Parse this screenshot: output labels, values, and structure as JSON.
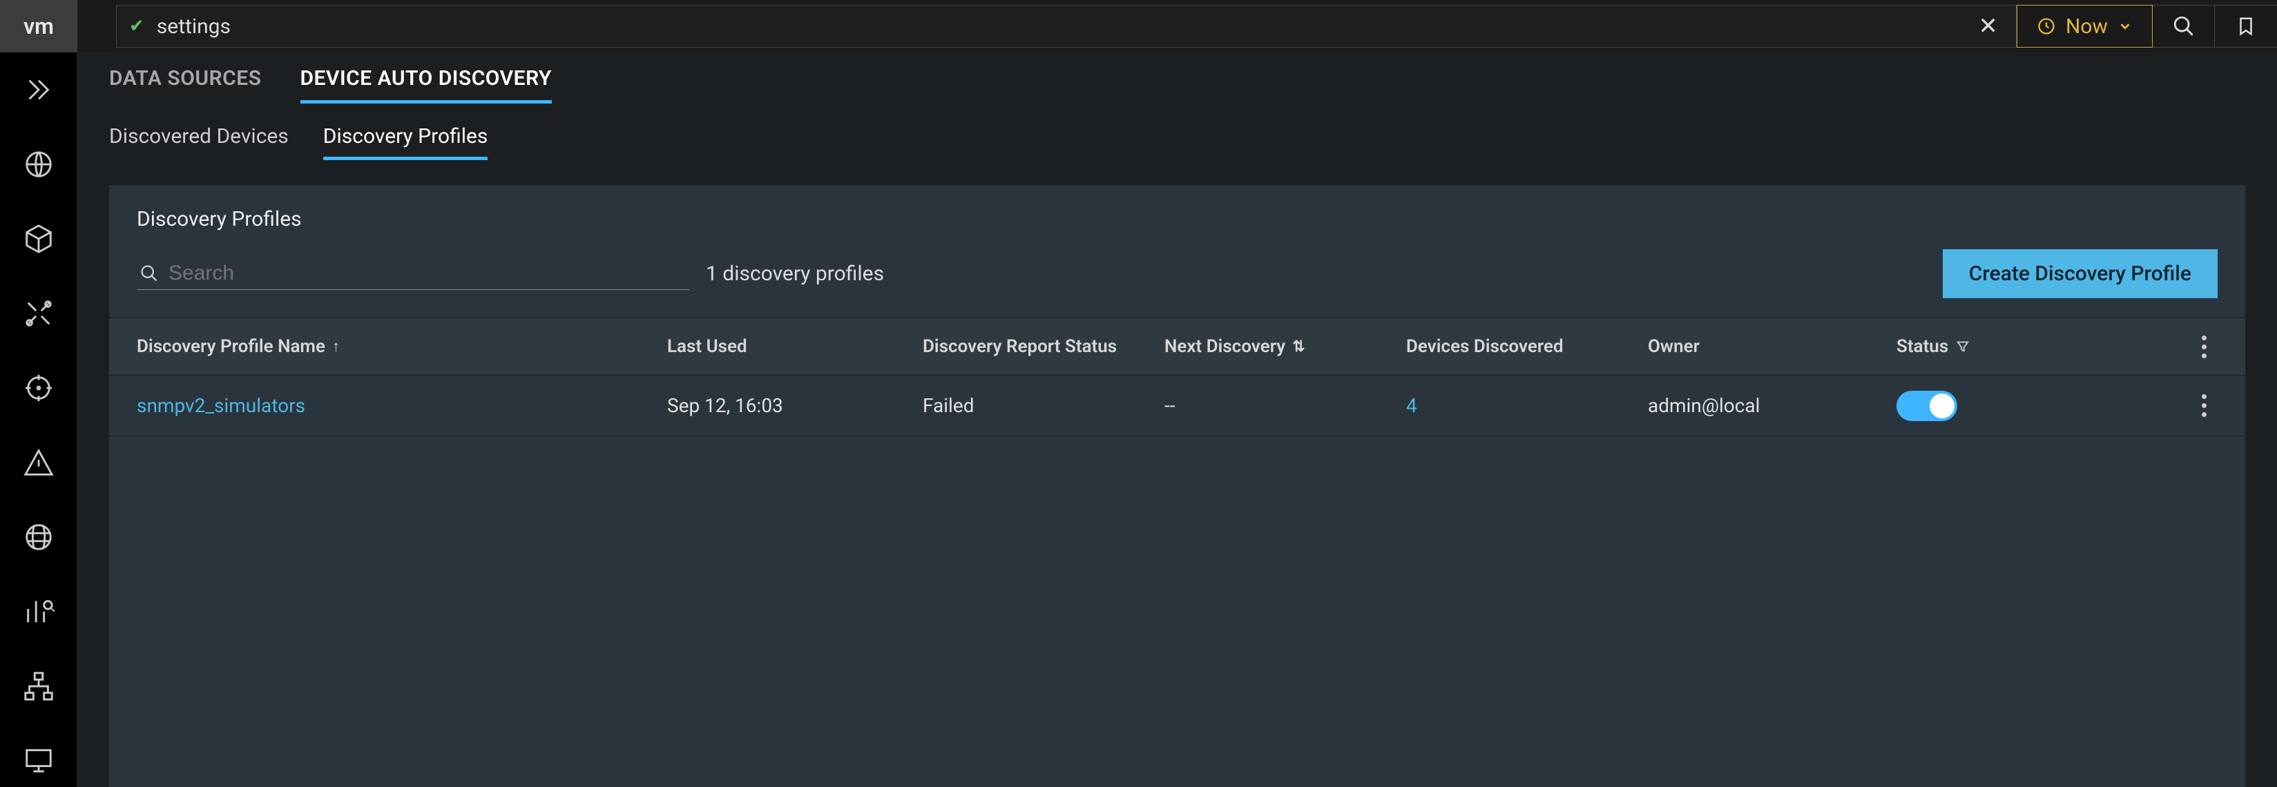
{
  "top": {
    "logo_text": "vm",
    "search_query": "settings",
    "clear_label": "✕",
    "now_label": "Now",
    "search_icon": "search",
    "bookmark_icon": "bookmark"
  },
  "sidenav": {
    "items": [
      "expand",
      "globe",
      "cube",
      "tools",
      "target",
      "warning",
      "internet",
      "analytics",
      "topology",
      "desktop"
    ]
  },
  "tabs_l1": [
    {
      "label": "DATA SOURCES",
      "active": false
    },
    {
      "label": "DEVICE AUTO DISCOVERY",
      "active": true
    }
  ],
  "tabs_l2": [
    {
      "label": "Discovered Devices",
      "active": false
    },
    {
      "label": "Discovery Profiles",
      "active": true
    }
  ],
  "panel": {
    "title": "Discovery Profiles",
    "search_placeholder": "Search",
    "count_text": "1 discovery profiles",
    "create_label": "Create Discovery Profile"
  },
  "table": {
    "columns": {
      "name": "Discovery Profile Name",
      "last_used": "Last Used",
      "report_status": "Discovery Report Status",
      "next_discovery": "Next Discovery",
      "devices_discovered": "Devices Discovered",
      "owner": "Owner",
      "status": "Status"
    },
    "sort": {
      "column": "name",
      "dir": "asc"
    },
    "rows": [
      {
        "name": "snmpv2_simulators",
        "last_used": "Sep 12, 16:03",
        "report_status": "Failed",
        "next_discovery": "--",
        "devices_discovered": "4",
        "owner": "admin@local",
        "status_enabled": true
      }
    ]
  }
}
